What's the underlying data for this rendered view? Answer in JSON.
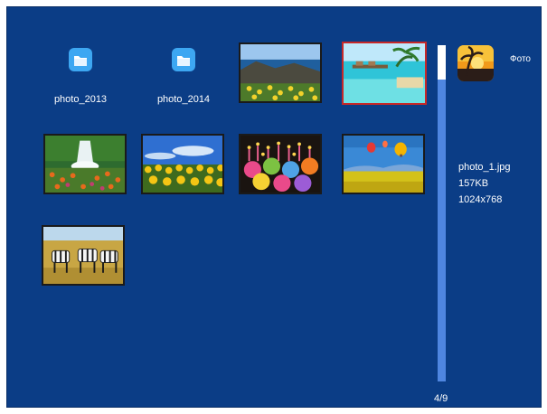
{
  "app": {
    "title": "Фото",
    "icon": "sunset-palm-icon"
  },
  "folders": [
    {
      "label": "photo_2013",
      "icon": "folder-icon"
    },
    {
      "label": "photo_2014",
      "icon": "folder-icon"
    }
  ],
  "thumbnails": [
    {
      "name": "coastal-rocks-flowers",
      "selected": false
    },
    {
      "name": "tropical-beach-bungalows",
      "selected": true
    },
    {
      "name": "waterfall-garden",
      "selected": false
    },
    {
      "name": "sunflower-field-sky",
      "selected": false
    },
    {
      "name": "cupcakes-candles",
      "selected": false
    },
    {
      "name": "hot-air-balloons-field",
      "selected": false
    },
    {
      "name": "zebras-savanna",
      "selected": false
    }
  ],
  "details": {
    "filename": "photo_1.jpg",
    "size": "157KB",
    "resolution": "1024x768"
  },
  "pagination": {
    "indicator": "4/9",
    "current": 4,
    "total": 9
  },
  "colors": {
    "background": "#0b3d86",
    "selection": "#c62828",
    "scrollbar": "#4f86e0"
  }
}
